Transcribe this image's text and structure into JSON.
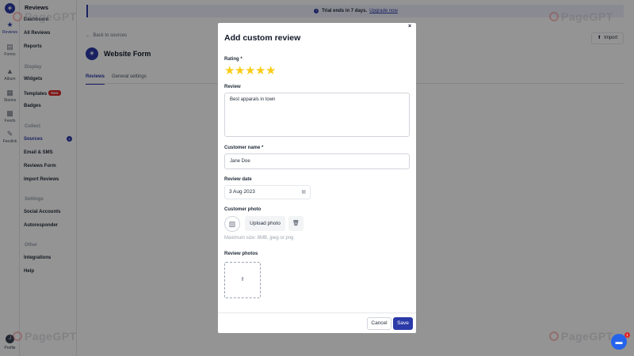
{
  "rail": {
    "items": [
      {
        "label": "Reviews",
        "icon": "star-icon"
      },
      {
        "label": "Forms",
        "icon": "clipboard-icon"
      },
      {
        "label": "Album",
        "icon": "image-icon"
      },
      {
        "label": "Stories",
        "icon": "stories-icon"
      },
      {
        "label": "Feeds",
        "icon": "grid-icon"
      },
      {
        "label": "Feedink",
        "icon": "feedback-icon"
      }
    ],
    "avatar_initial": "J",
    "profile_label": "Profile"
  },
  "sidebar": {
    "title": "Reviews",
    "items_top": [
      "Dashboard",
      "All Reviews",
      "Reports"
    ],
    "display_section": "Display",
    "display_items": [
      "Widgets",
      "Templates",
      "Badges"
    ],
    "templates_badge": "New",
    "collect_section": "Collect",
    "collect_items": [
      "Sources",
      "Email & SMS",
      "Reviews Form",
      "Import Reviews"
    ],
    "sources_count": "4",
    "settings_section": "Settings",
    "settings_items": [
      "Social Accounts",
      "Autoresponder"
    ],
    "other_section": "Other",
    "other_items": [
      "Integrations",
      "Help"
    ]
  },
  "main": {
    "trial_text": "Trial ends in 7 days.",
    "upgrade_link": "Upgrade now",
    "back_label": "Back to sources",
    "import_label": "Import",
    "form_title": "Website Form",
    "tabs": [
      "Reviews",
      "General settings"
    ]
  },
  "modal": {
    "title": "Add custom review",
    "close_symbol": "×",
    "rating_label": "Rating *",
    "rating_value": 5,
    "rating_max": 5,
    "review_label": "Review",
    "review_value": "Best apparals in town",
    "customer_name_label": "Customer name *",
    "customer_name_value": "Jane Doe",
    "review_date_label": "Review date",
    "review_date_value": "3 Aug 2023",
    "customer_photo_label": "Customer photo",
    "upload_photo_label": "Upload photo",
    "max_size_hint": "Maximum size: 8MB, jpeg or png",
    "review_photos_label": "Review photos",
    "cancel_label": "Cancel",
    "save_label": "Save"
  },
  "chat": {
    "badge": "1"
  },
  "watermark": "PageGPT",
  "colors": {
    "accent": "#2b3aa8",
    "star": "#facc15",
    "overlay": "rgba(0,0,0,0.42)",
    "badge_red": "#dc2626",
    "chat_blue": "#2563eb"
  }
}
